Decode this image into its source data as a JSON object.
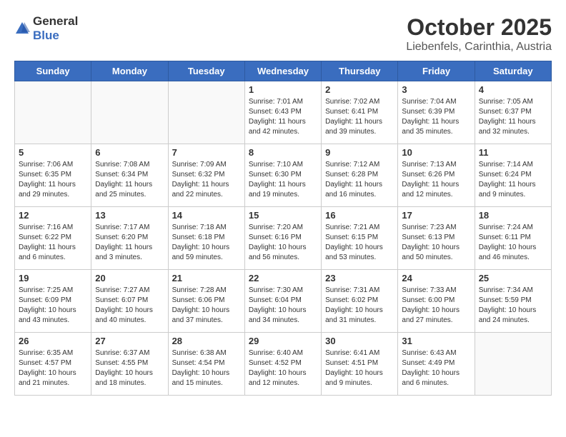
{
  "logo": {
    "general": "General",
    "blue": "Blue"
  },
  "title": "October 2025",
  "subtitle": "Liebenfels, Carinthia, Austria",
  "headers": [
    "Sunday",
    "Monday",
    "Tuesday",
    "Wednesday",
    "Thursday",
    "Friday",
    "Saturday"
  ],
  "weeks": [
    [
      {
        "day": "",
        "info": "",
        "empty": true
      },
      {
        "day": "",
        "info": "",
        "empty": true
      },
      {
        "day": "",
        "info": "",
        "empty": true
      },
      {
        "day": "1",
        "info": "Sunrise: 7:01 AM\nSunset: 6:43 PM\nDaylight: 11 hours\nand 42 minutes."
      },
      {
        "day": "2",
        "info": "Sunrise: 7:02 AM\nSunset: 6:41 PM\nDaylight: 11 hours\nand 39 minutes."
      },
      {
        "day": "3",
        "info": "Sunrise: 7:04 AM\nSunset: 6:39 PM\nDaylight: 11 hours\nand 35 minutes."
      },
      {
        "day": "4",
        "info": "Sunrise: 7:05 AM\nSunset: 6:37 PM\nDaylight: 11 hours\nand 32 minutes."
      }
    ],
    [
      {
        "day": "5",
        "info": "Sunrise: 7:06 AM\nSunset: 6:35 PM\nDaylight: 11 hours\nand 29 minutes."
      },
      {
        "day": "6",
        "info": "Sunrise: 7:08 AM\nSunset: 6:34 PM\nDaylight: 11 hours\nand 25 minutes."
      },
      {
        "day": "7",
        "info": "Sunrise: 7:09 AM\nSunset: 6:32 PM\nDaylight: 11 hours\nand 22 minutes."
      },
      {
        "day": "8",
        "info": "Sunrise: 7:10 AM\nSunset: 6:30 PM\nDaylight: 11 hours\nand 19 minutes."
      },
      {
        "day": "9",
        "info": "Sunrise: 7:12 AM\nSunset: 6:28 PM\nDaylight: 11 hours\nand 16 minutes."
      },
      {
        "day": "10",
        "info": "Sunrise: 7:13 AM\nSunset: 6:26 PM\nDaylight: 11 hours\nand 12 minutes."
      },
      {
        "day": "11",
        "info": "Sunrise: 7:14 AM\nSunset: 6:24 PM\nDaylight: 11 hours\nand 9 minutes."
      }
    ],
    [
      {
        "day": "12",
        "info": "Sunrise: 7:16 AM\nSunset: 6:22 PM\nDaylight: 11 hours\nand 6 minutes."
      },
      {
        "day": "13",
        "info": "Sunrise: 7:17 AM\nSunset: 6:20 PM\nDaylight: 11 hours\nand 3 minutes."
      },
      {
        "day": "14",
        "info": "Sunrise: 7:18 AM\nSunset: 6:18 PM\nDaylight: 10 hours\nand 59 minutes."
      },
      {
        "day": "15",
        "info": "Sunrise: 7:20 AM\nSunset: 6:16 PM\nDaylight: 10 hours\nand 56 minutes."
      },
      {
        "day": "16",
        "info": "Sunrise: 7:21 AM\nSunset: 6:15 PM\nDaylight: 10 hours\nand 53 minutes."
      },
      {
        "day": "17",
        "info": "Sunrise: 7:23 AM\nSunset: 6:13 PM\nDaylight: 10 hours\nand 50 minutes."
      },
      {
        "day": "18",
        "info": "Sunrise: 7:24 AM\nSunset: 6:11 PM\nDaylight: 10 hours\nand 46 minutes."
      }
    ],
    [
      {
        "day": "19",
        "info": "Sunrise: 7:25 AM\nSunset: 6:09 PM\nDaylight: 10 hours\nand 43 minutes."
      },
      {
        "day": "20",
        "info": "Sunrise: 7:27 AM\nSunset: 6:07 PM\nDaylight: 10 hours\nand 40 minutes."
      },
      {
        "day": "21",
        "info": "Sunrise: 7:28 AM\nSunset: 6:06 PM\nDaylight: 10 hours\nand 37 minutes."
      },
      {
        "day": "22",
        "info": "Sunrise: 7:30 AM\nSunset: 6:04 PM\nDaylight: 10 hours\nand 34 minutes."
      },
      {
        "day": "23",
        "info": "Sunrise: 7:31 AM\nSunset: 6:02 PM\nDaylight: 10 hours\nand 31 minutes."
      },
      {
        "day": "24",
        "info": "Sunrise: 7:33 AM\nSunset: 6:00 PM\nDaylight: 10 hours\nand 27 minutes."
      },
      {
        "day": "25",
        "info": "Sunrise: 7:34 AM\nSunset: 5:59 PM\nDaylight: 10 hours\nand 24 minutes."
      }
    ],
    [
      {
        "day": "26",
        "info": "Sunrise: 6:35 AM\nSunset: 4:57 PM\nDaylight: 10 hours\nand 21 minutes."
      },
      {
        "day": "27",
        "info": "Sunrise: 6:37 AM\nSunset: 4:55 PM\nDaylight: 10 hours\nand 18 minutes."
      },
      {
        "day": "28",
        "info": "Sunrise: 6:38 AM\nSunset: 4:54 PM\nDaylight: 10 hours\nand 15 minutes."
      },
      {
        "day": "29",
        "info": "Sunrise: 6:40 AM\nSunset: 4:52 PM\nDaylight: 10 hours\nand 12 minutes."
      },
      {
        "day": "30",
        "info": "Sunrise: 6:41 AM\nSunset: 4:51 PM\nDaylight: 10 hours\nand 9 minutes."
      },
      {
        "day": "31",
        "info": "Sunrise: 6:43 AM\nSunset: 4:49 PM\nDaylight: 10 hours\nand 6 minutes."
      },
      {
        "day": "",
        "info": "",
        "empty": true
      }
    ]
  ]
}
